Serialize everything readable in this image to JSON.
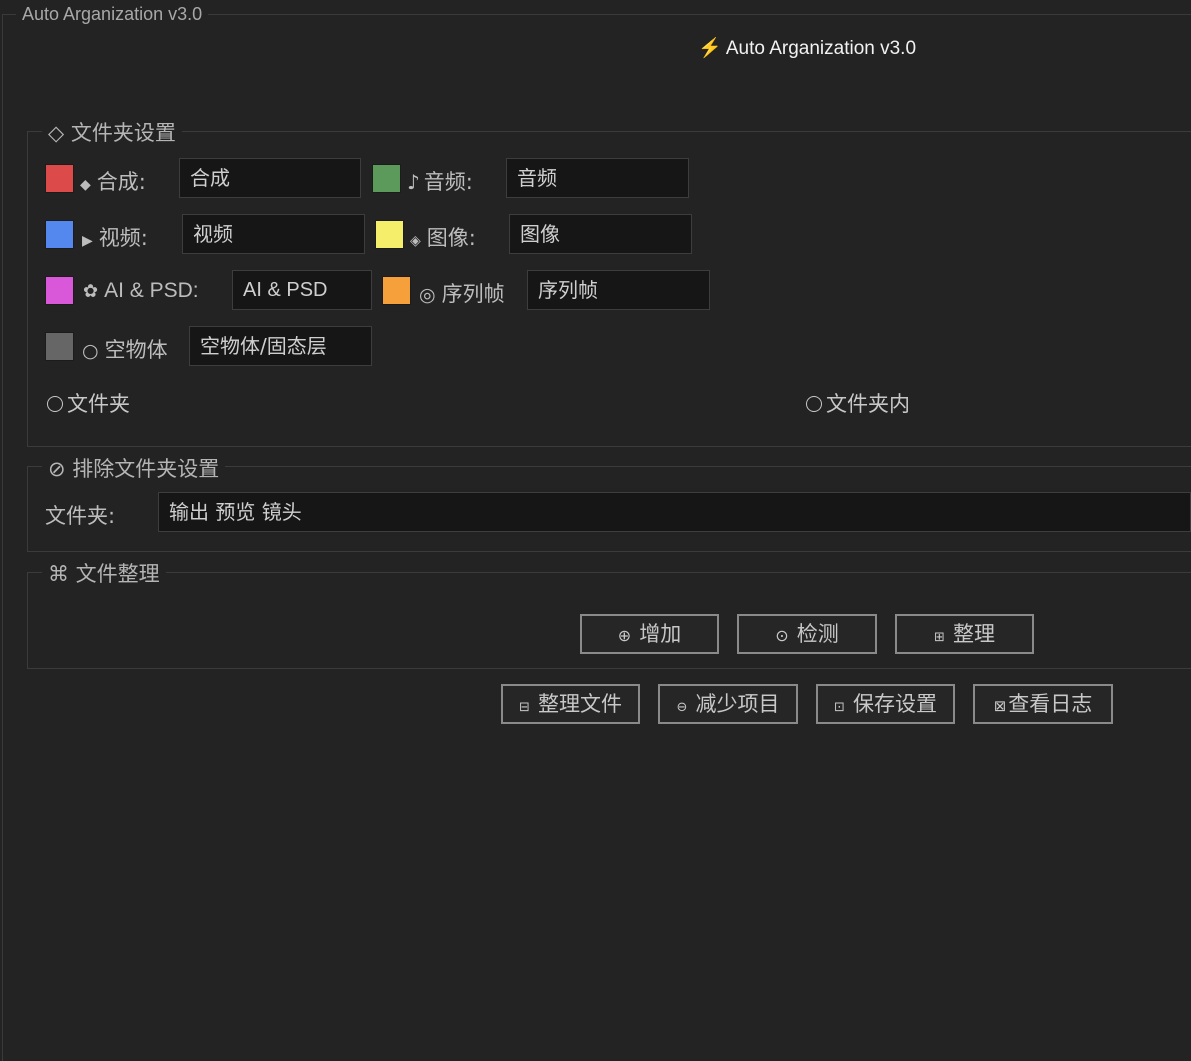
{
  "window": {
    "title": "Auto Arganization v3.0"
  },
  "header": {
    "title": "⚡ Auto Arganization v3.0"
  },
  "folder_settings": {
    "title": "◇ 文件夹设置",
    "rows": [
      {
        "color": "#dd4a4a",
        "icon": "◆",
        "label": "合成:",
        "value": "合成"
      },
      {
        "color": "#5c9a5c",
        "icon": "♪",
        "label": "音频:",
        "value": "音频"
      },
      {
        "color": "#5588ee",
        "icon": "▶",
        "label": "视频:",
        "value": "视频"
      },
      {
        "color": "#f5ee6a",
        "icon": "◈",
        "label": "图像:",
        "value": "图像"
      },
      {
        "color": "#d957d9",
        "icon": "✿",
        "label": "AI & PSD:",
        "value": "AI & PSD"
      },
      {
        "color": "#f5a03a",
        "icon": "◎",
        "label": "序列帧",
        "value": "序列帧"
      },
      {
        "color": "#666666",
        "icon": "○",
        "label": "空物体",
        "value": "空物体/固态层"
      }
    ],
    "radio_folder": "文件夹",
    "radio_inside": "文件夹内"
  },
  "exclude_settings": {
    "title": "⊘ 排除文件夹设置",
    "label": "文件夹:",
    "value": "输出 预览 镜头"
  },
  "organize": {
    "title": "⌘ 文件整理",
    "buttons": [
      {
        "icon": "⊕",
        "label": "增加"
      },
      {
        "icon": "⊙",
        "label": "检测"
      },
      {
        "icon": "⊞",
        "label": "整理"
      }
    ]
  },
  "footer_buttons": [
    {
      "icon": "⊟",
      "label": "整理文件"
    },
    {
      "icon": "⊖",
      "label": "减少项目"
    },
    {
      "icon": "⊡",
      "label": "保存设置"
    },
    {
      "icon": "⊠",
      "label": "查看日志"
    }
  ]
}
